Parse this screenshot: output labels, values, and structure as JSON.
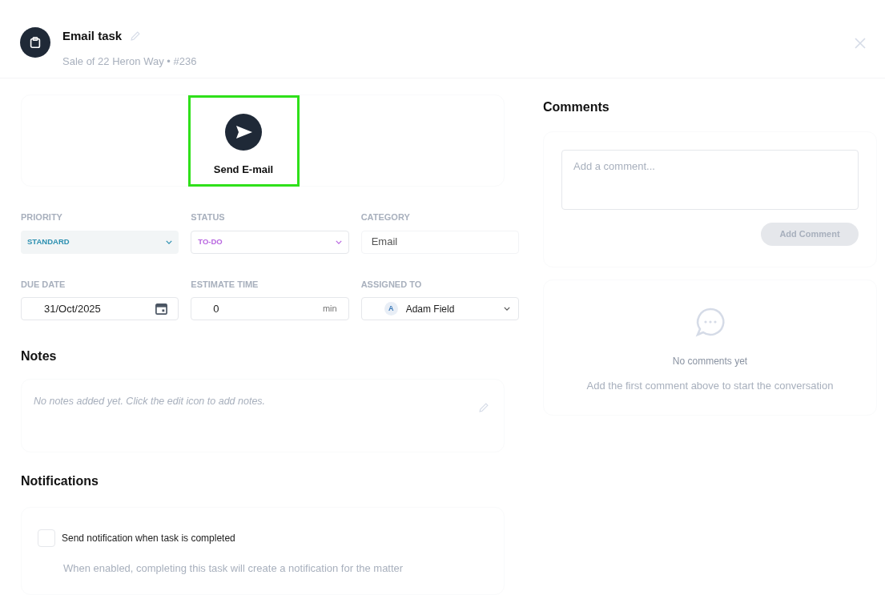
{
  "header": {
    "title": "Email task",
    "subtitle": "Sale of 22 Heron Way • #236"
  },
  "action": {
    "label": "Send E-mail",
    "highlighted": true
  },
  "fields": [
    {
      "kind": "select",
      "label": "PRIORITY",
      "value": "STANDARD",
      "color": "#2b8fb0"
    },
    {
      "kind": "select",
      "label": "STATUS",
      "value": "TO-DO",
      "color": "#b866e0"
    },
    {
      "kind": "text",
      "label": "CATEGORY",
      "value": "Email"
    },
    {
      "kind": "date",
      "label": "DUE DATE",
      "value": "31/Oct/2025"
    },
    {
      "kind": "number",
      "label": "ESTIMATE TIME",
      "value": "0",
      "unit": "min"
    },
    {
      "kind": "person",
      "label": "ASSIGNED TO",
      "value": "Adam Field",
      "initial": "A"
    }
  ],
  "notes": {
    "title": "Notes",
    "empty_text": "No notes added yet. Click the edit icon to add notes."
  },
  "notifications": {
    "title": "Notifications",
    "option": {
      "label": "Send notification when task is completed",
      "checked": false
    },
    "hint": "When enabled, completing this task will create a notification for the matter"
  },
  "comments": {
    "title": "Comments",
    "placeholder": "Add a comment...",
    "button": "Add Comment",
    "empty_title": "No comments yet",
    "empty_text": "Add the first comment above to start the conversation"
  }
}
